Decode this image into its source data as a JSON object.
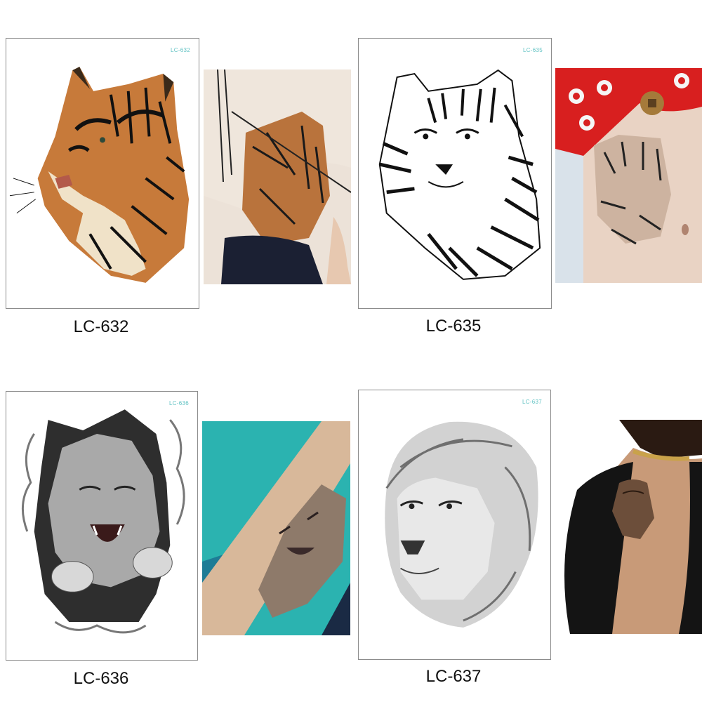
{
  "products": [
    {
      "code": "LC-632",
      "sheet_code": "LC-632",
      "subject": "tiger-color-icon",
      "caption": "LC-632"
    },
    {
      "code": "LC-635",
      "sheet_code": "LC-635",
      "subject": "tiger-bw-icon",
      "caption": "LC-635"
    },
    {
      "code": "LC-636",
      "sheet_code": "LC-636",
      "subject": "lion-breaking-out-icon",
      "caption": "LC-636"
    },
    {
      "code": "LC-637",
      "sheet_code": "LC-637",
      "subject": "lion-head-icon",
      "caption": "LC-637"
    }
  ],
  "colors": {
    "sheet_border": "#8c8c8c",
    "sheet_code_text": "#63c3c4",
    "caption_text": "#111111"
  }
}
